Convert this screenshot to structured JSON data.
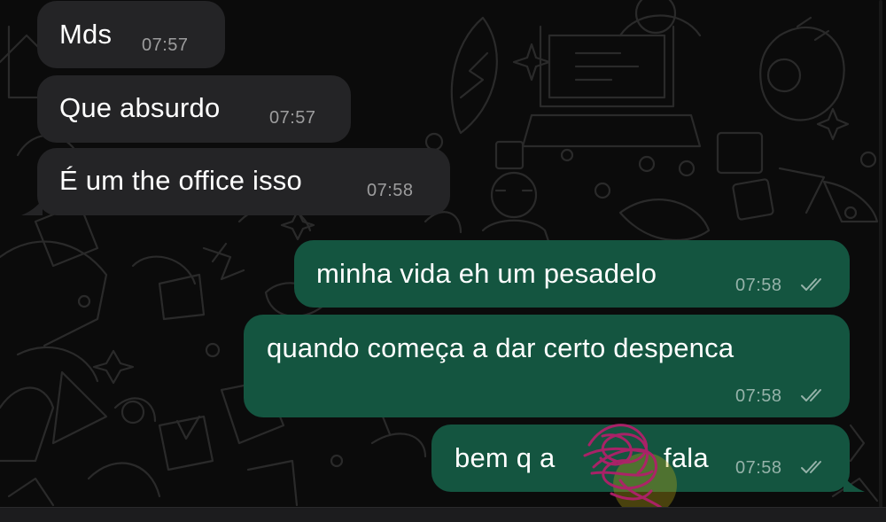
{
  "conversation": {
    "incoming": [
      {
        "text": "Mds",
        "time": "07:57"
      },
      {
        "text": "Que absurdo",
        "time": "07:57"
      },
      {
        "text": "É um the office isso",
        "time": "07:58"
      }
    ],
    "outgoing": [
      {
        "text": "minha vida eh um pesadelo",
        "time": "07:58",
        "status": "read"
      },
      {
        "text": "quando começa a dar certo despenca",
        "time": "07:58",
        "status": "read"
      },
      {
        "text_before": "bem q a",
        "text_after": "fala",
        "time": "07:58",
        "status": "read"
      }
    ]
  },
  "colors": {
    "incoming_bubble": "#242426",
    "outgoing_bubble": "#145540",
    "background": "#0b0b0b",
    "scribble": "#b0206a"
  },
  "icons": {
    "read_receipt": "double-check-icon",
    "redaction": "scribble-redaction"
  }
}
